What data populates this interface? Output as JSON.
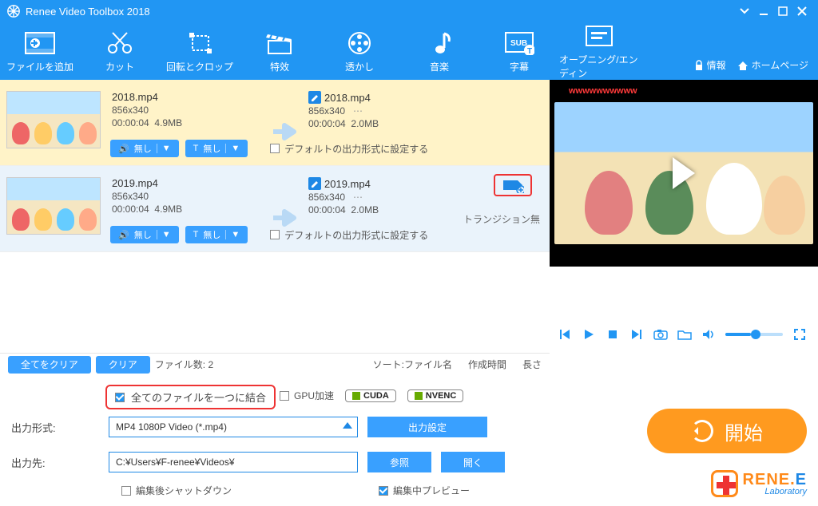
{
  "title": "Renee Video Toolbox 2018",
  "toolbar": [
    {
      "id": "add-file",
      "label": "ファイルを追加"
    },
    {
      "id": "cut",
      "label": "カット"
    },
    {
      "id": "rotate-crop",
      "label": "回転とクロップ"
    },
    {
      "id": "effects",
      "label": "特效"
    },
    {
      "id": "watermark",
      "label": "透かし"
    },
    {
      "id": "music",
      "label": "音楽"
    },
    {
      "id": "subtitle",
      "label": "字幕"
    },
    {
      "id": "opening-ending",
      "label": "オープニング/エンディン"
    }
  ],
  "header_links": {
    "info": "情報",
    "home": "ホームページ"
  },
  "rows": [
    {
      "src_name": "2018.mp4",
      "src_dims": "856x340",
      "src_dur": "00:00:04",
      "src_size": "4.9MB",
      "out_name": "2018.mp4",
      "out_dims": "856x340",
      "out_dur": "00:00:04",
      "out_size": "2.0MB",
      "audio": "無し",
      "text": "無し",
      "default_fmt": "デフォルトの出力形式に設定する"
    },
    {
      "src_name": "2019.mp4",
      "src_dims": "856x340",
      "src_dur": "00:00:04",
      "src_size": "4.9MB",
      "out_name": "2019.mp4",
      "out_dims": "856x340",
      "out_dur": "00:00:04",
      "out_size": "2.0MB",
      "audio": "無し",
      "text": "無し",
      "default_fmt": "デフォルトの出力形式に設定する",
      "transition": "トランジション無"
    }
  ],
  "preview": {
    "watermark": "wwwwwwwwww"
  },
  "midbar": {
    "clear_all": "全てをクリア",
    "clear": "クリア",
    "file_count_label": "ファイル数:",
    "file_count": "2",
    "sort_label": "ソート:",
    "sort_name": "ファイル名",
    "sort_created": "作成時間",
    "sort_length": "長さ"
  },
  "bottom": {
    "merge_label": "全てのファイルを一つに結合",
    "gpu_label": "GPU加速",
    "cuda": "CUDA",
    "nvenc": "NVENC",
    "format_label": "出力形式:",
    "format_value": "MP4 1080P Video (*.mp4)",
    "format_settings": "出力設定",
    "dest_label": "出力先:",
    "dest_value": "C:¥Users¥F-renee¥Videos¥",
    "browse": "参照",
    "open": "開く",
    "shutdown": "編集後シャットダウン",
    "preview_editing": "編集中プレビュー",
    "start": "開始"
  },
  "brand": {
    "line1a": "RENE.",
    "line1b": "E",
    "line2": "Laboratory"
  }
}
